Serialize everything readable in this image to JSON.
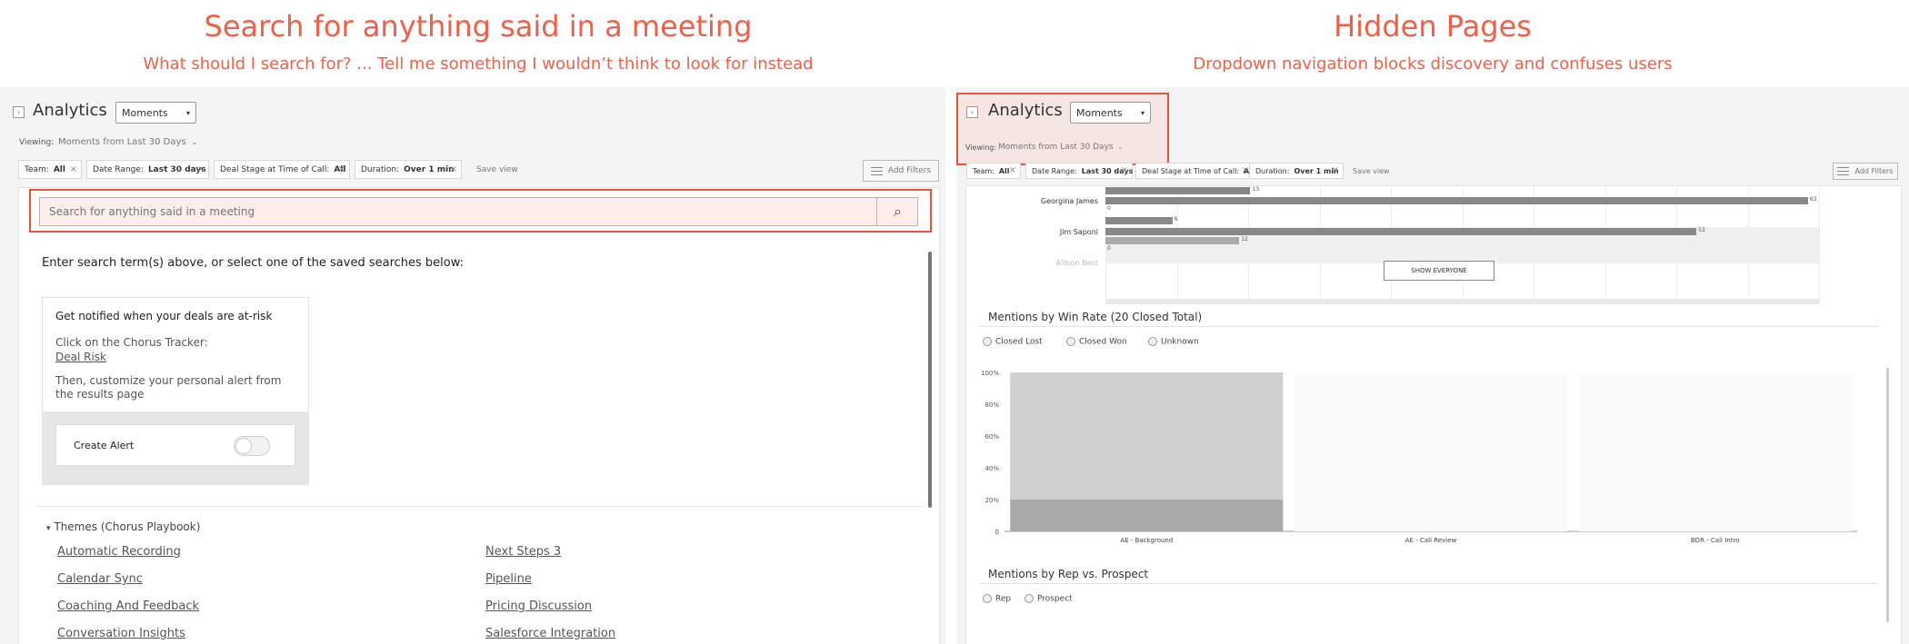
{
  "left_header": {
    "title": "Search for anything said in a meeting",
    "subtitle": "What should I search for? ... Tell me something I wouldn’t think to look for instead"
  },
  "right_header": {
    "title": "Hidden Pages",
    "subtitle": "Dropdown navigation blocks discovery and confuses users"
  },
  "left_panel": {
    "back_icon": "‹",
    "app_title": "Analytics",
    "view_select": "Moments",
    "viewing_label": "Viewing:",
    "viewing_value": "Moments from Last 30 Days",
    "filters": [
      {
        "label": "Team:",
        "value": "All"
      },
      {
        "label": "Date Range:",
        "value": "Last 30 days"
      },
      {
        "label": "Deal Stage at Time of Call:",
        "value": "All"
      },
      {
        "label": "Duration:",
        "value": "Over 1 min"
      }
    ],
    "filter_remove": "×",
    "save_view": "Save view",
    "add_filters": "Add Filters",
    "search_placeholder": "Search for anything said in a meeting",
    "search_icon": "⌕",
    "instructions": "Enter search term(s) above, or select one of the saved searches below:",
    "card": {
      "title": "Get notified when your deals are at-risk",
      "line1": "Click on the Chorus Tracker:",
      "tracker_link": "Deal Risk",
      "line2": "Then, customize your personal alert from the results page",
      "alert_label": "Create Alert"
    },
    "themes_toggle": "▾",
    "themes_header": "Themes (Chorus Playbook)",
    "themes_col1": [
      "Automatic Recording",
      "Calendar Sync",
      "Coaching And Feedback",
      "Conversation Insights"
    ],
    "themes_col2": [
      "Next Steps 3",
      "Pipeline",
      "Pricing Discussion",
      "Salesforce Integration"
    ]
  },
  "right_panel": {
    "back_icon": "‹",
    "app_title": "Analytics",
    "view_select": "Moments",
    "viewing_label": "Viewing:",
    "viewing_value": "Moments from Last 30 Days",
    "filters": [
      {
        "label": "Team:",
        "value": "All"
      },
      {
        "label": "Date Range:",
        "value": "Last 30 days"
      },
      {
        "label": "Deal Stage at Time of Call:",
        "value": "All"
      },
      {
        "label": "Duration:",
        "value": "Over 1 min"
      }
    ],
    "filter_remove": "×",
    "save_view": "Save view",
    "add_filters": "Add Filters",
    "rep_rows": [
      {
        "name": "",
        "bars": [
          {
            "value": 13,
            "shade": "dark"
          }
        ]
      },
      {
        "name": "Georgina James",
        "bars": [
          {
            "value": 63,
            "shade": "dark"
          },
          {
            "value": 0,
            "shade": "light"
          }
        ]
      },
      {
        "name": "Jim Saponi",
        "bars": [
          {
            "value": 6,
            "shade": "dark"
          },
          {
            "value": 53,
            "shade": "dark"
          },
          {
            "value": 12,
            "shade": "light"
          },
          {
            "value": 0,
            "shade": "light"
          }
        ]
      },
      {
        "name": "Allison Best",
        "bars": []
      }
    ],
    "show_everyone": "SHOW EVERYONE",
    "win_rate_title": "Mentions by Win Rate (20 Closed Total)",
    "win_rate_legend": [
      "Closed Lost",
      "Closed Won",
      "Unknown"
    ],
    "rep_prospect_title": "Mentions by Rep vs. Prospect",
    "rep_prospect_legend": [
      "Rep",
      "Prospect"
    ]
  },
  "chart_data": [
    {
      "type": "bar",
      "orientation": "horizontal",
      "categories": [
        "",
        "Georgina James",
        "Jim Saponi"
      ],
      "series": [
        {
          "values": [
            13,
            63,
            53
          ]
        },
        {
          "values": [
            null,
            0,
            12
          ]
        },
        {
          "values": [
            null,
            null,
            6
          ]
        }
      ],
      "xlim": [
        0,
        64
      ]
    },
    {
      "type": "bar",
      "stacked": true,
      "title": "Mentions by Win Rate (20 Closed Total)",
      "categories": [
        "AE - Background",
        "AE - Call Review",
        "BDR - Call Intro"
      ],
      "yticks": [
        "0",
        "20%",
        "40%",
        "60%",
        "80%",
        "100%"
      ],
      "ylim": [
        0,
        100
      ],
      "series": [
        {
          "name": "Closed Lost",
          "values": [
            20,
            0,
            0
          ]
        },
        {
          "name": "Closed Won",
          "values": [
            80,
            0,
            0
          ]
        },
        {
          "name": "Unknown",
          "values": [
            0,
            0,
            0
          ]
        }
      ],
      "legend": "top-left"
    }
  ]
}
